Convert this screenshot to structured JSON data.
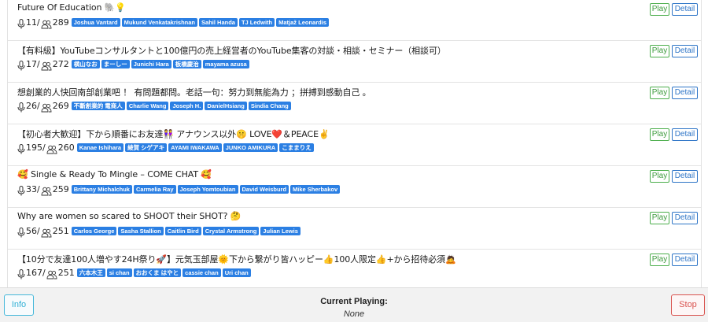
{
  "rooms": [
    {
      "title": "Future Of Education 🐘💡",
      "speakers": "11",
      "listeners": "289",
      "users": [
        "Joshua Vantard",
        "Mukund Venkatakrishnan",
        "Sahil Handa",
        "TJ Ledwith",
        "Matjaž Leonardis"
      ]
    },
    {
      "title": "【有料級】YouTubeコンサルタントと100億円の売上経営者のYouTube集客の対談・相談・セミナー（相談可）",
      "speakers": "17",
      "listeners": "272",
      "users": [
        "横山なお",
        "まーしー",
        "Junichi Hara",
        "板橋慶治",
        "mayama azusa"
      ]
    },
    {
      "title": "想創業的人快回南部創業吧 ！ 有問題都問。老話一句：努力到無能為力 ；拼搏到感動自己 。",
      "speakers": "26",
      "listeners": "269",
      "users": [
        "不斷創業的 電商人",
        "Charlie Wang",
        "Joseph H.",
        "DanielHsiang",
        "Sindia Chang"
      ]
    },
    {
      "title": "【初心者大歓迎】下から順番にお友達👭 アナウンス以外🤫 LOVE❤️＆PEACE✌️",
      "speakers": "195",
      "listeners": "260",
      "users": [
        "Kanae Ishihara",
        "綾賀 シゲアキ",
        "AYAMI IWAKAWA",
        "JUNKO AMIKURA",
        "こままりえ"
      ]
    },
    {
      "title": "🥰 Single & Ready To Mingle – COME CHAT 🥰",
      "speakers": "33",
      "listeners": "259",
      "users": [
        "Brittany Michalchuk",
        "Carmelia Ray",
        "Joseph Yomtoubian",
        "David Weisburd",
        "Mike Sherbakov"
      ]
    },
    {
      "title": "Why are women so scared to SHOOT their SHOT? 🤔",
      "speakers": "56",
      "listeners": "251",
      "users": [
        "Carlos George",
        "Sasha Stallion",
        "Caitlin Bird",
        "Crystal Armstrong",
        "Julian Lewis"
      ]
    },
    {
      "title": "【10分で友達100人増やす24H祭り🚀】元気玉部屋🌞下から繋がり皆ハッピー👍100人限定👍+から招待必須🙇",
      "speakers": "167",
      "listeners": "251",
      "users": [
        "六本木王",
        "si chan",
        "おおくま はやと",
        "cassie chan",
        "Uri chan"
      ]
    }
  ],
  "buttons": {
    "play": "Play",
    "detail": "Detail",
    "info": "Info",
    "stop": "Stop"
  },
  "footer": {
    "current_playing_label": "Current Playing:",
    "current_playing_value": "None"
  },
  "colors": {
    "tag": "#2b7fe3",
    "play": "#4cae4c",
    "detail": "#2e75c7",
    "info": "#46b8da",
    "stop": "#d9534f"
  }
}
